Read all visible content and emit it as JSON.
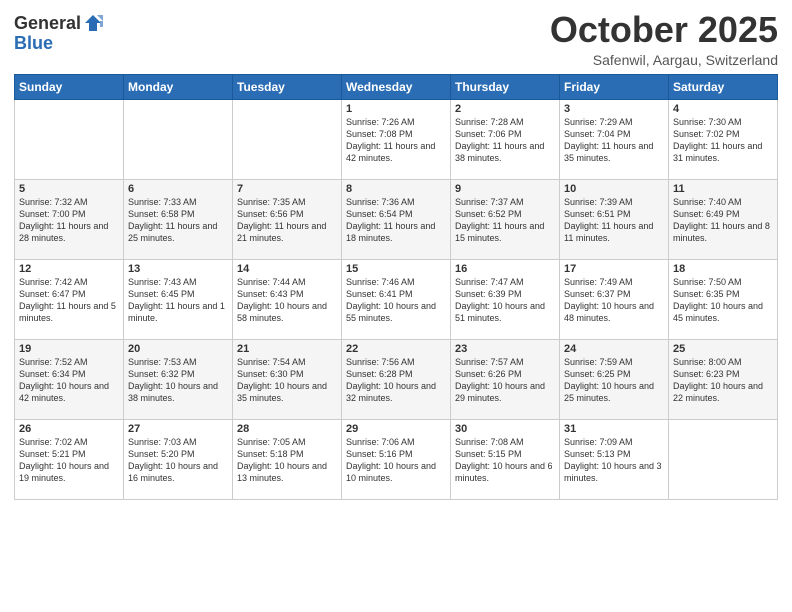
{
  "logo": {
    "general": "General",
    "blue": "Blue"
  },
  "title": "October 2025",
  "location": "Safenwil, Aargau, Switzerland",
  "days_of_week": [
    "Sunday",
    "Monday",
    "Tuesday",
    "Wednesday",
    "Thursday",
    "Friday",
    "Saturday"
  ],
  "weeks": [
    [
      {
        "num": "",
        "info": ""
      },
      {
        "num": "",
        "info": ""
      },
      {
        "num": "",
        "info": ""
      },
      {
        "num": "1",
        "info": "Sunrise: 7:26 AM\nSunset: 7:08 PM\nDaylight: 11 hours and 42 minutes."
      },
      {
        "num": "2",
        "info": "Sunrise: 7:28 AM\nSunset: 7:06 PM\nDaylight: 11 hours and 38 minutes."
      },
      {
        "num": "3",
        "info": "Sunrise: 7:29 AM\nSunset: 7:04 PM\nDaylight: 11 hours and 35 minutes."
      },
      {
        "num": "4",
        "info": "Sunrise: 7:30 AM\nSunset: 7:02 PM\nDaylight: 11 hours and 31 minutes."
      }
    ],
    [
      {
        "num": "5",
        "info": "Sunrise: 7:32 AM\nSunset: 7:00 PM\nDaylight: 11 hours and 28 minutes."
      },
      {
        "num": "6",
        "info": "Sunrise: 7:33 AM\nSunset: 6:58 PM\nDaylight: 11 hours and 25 minutes."
      },
      {
        "num": "7",
        "info": "Sunrise: 7:35 AM\nSunset: 6:56 PM\nDaylight: 11 hours and 21 minutes."
      },
      {
        "num": "8",
        "info": "Sunrise: 7:36 AM\nSunset: 6:54 PM\nDaylight: 11 hours and 18 minutes."
      },
      {
        "num": "9",
        "info": "Sunrise: 7:37 AM\nSunset: 6:52 PM\nDaylight: 11 hours and 15 minutes."
      },
      {
        "num": "10",
        "info": "Sunrise: 7:39 AM\nSunset: 6:51 PM\nDaylight: 11 hours and 11 minutes."
      },
      {
        "num": "11",
        "info": "Sunrise: 7:40 AM\nSunset: 6:49 PM\nDaylight: 11 hours and 8 minutes."
      }
    ],
    [
      {
        "num": "12",
        "info": "Sunrise: 7:42 AM\nSunset: 6:47 PM\nDaylight: 11 hours and 5 minutes."
      },
      {
        "num": "13",
        "info": "Sunrise: 7:43 AM\nSunset: 6:45 PM\nDaylight: 11 hours and 1 minute."
      },
      {
        "num": "14",
        "info": "Sunrise: 7:44 AM\nSunset: 6:43 PM\nDaylight: 10 hours and 58 minutes."
      },
      {
        "num": "15",
        "info": "Sunrise: 7:46 AM\nSunset: 6:41 PM\nDaylight: 10 hours and 55 minutes."
      },
      {
        "num": "16",
        "info": "Sunrise: 7:47 AM\nSunset: 6:39 PM\nDaylight: 10 hours and 51 minutes."
      },
      {
        "num": "17",
        "info": "Sunrise: 7:49 AM\nSunset: 6:37 PM\nDaylight: 10 hours and 48 minutes."
      },
      {
        "num": "18",
        "info": "Sunrise: 7:50 AM\nSunset: 6:35 PM\nDaylight: 10 hours and 45 minutes."
      }
    ],
    [
      {
        "num": "19",
        "info": "Sunrise: 7:52 AM\nSunset: 6:34 PM\nDaylight: 10 hours and 42 minutes."
      },
      {
        "num": "20",
        "info": "Sunrise: 7:53 AM\nSunset: 6:32 PM\nDaylight: 10 hours and 38 minutes."
      },
      {
        "num": "21",
        "info": "Sunrise: 7:54 AM\nSunset: 6:30 PM\nDaylight: 10 hours and 35 minutes."
      },
      {
        "num": "22",
        "info": "Sunrise: 7:56 AM\nSunset: 6:28 PM\nDaylight: 10 hours and 32 minutes."
      },
      {
        "num": "23",
        "info": "Sunrise: 7:57 AM\nSunset: 6:26 PM\nDaylight: 10 hours and 29 minutes."
      },
      {
        "num": "24",
        "info": "Sunrise: 7:59 AM\nSunset: 6:25 PM\nDaylight: 10 hours and 25 minutes."
      },
      {
        "num": "25",
        "info": "Sunrise: 8:00 AM\nSunset: 6:23 PM\nDaylight: 10 hours and 22 minutes."
      }
    ],
    [
      {
        "num": "26",
        "info": "Sunrise: 7:02 AM\nSunset: 5:21 PM\nDaylight: 10 hours and 19 minutes."
      },
      {
        "num": "27",
        "info": "Sunrise: 7:03 AM\nSunset: 5:20 PM\nDaylight: 10 hours and 16 minutes."
      },
      {
        "num": "28",
        "info": "Sunrise: 7:05 AM\nSunset: 5:18 PM\nDaylight: 10 hours and 13 minutes."
      },
      {
        "num": "29",
        "info": "Sunrise: 7:06 AM\nSunset: 5:16 PM\nDaylight: 10 hours and 10 minutes."
      },
      {
        "num": "30",
        "info": "Sunrise: 7:08 AM\nSunset: 5:15 PM\nDaylight: 10 hours and 6 minutes."
      },
      {
        "num": "31",
        "info": "Sunrise: 7:09 AM\nSunset: 5:13 PM\nDaylight: 10 hours and 3 minutes."
      },
      {
        "num": "",
        "info": ""
      }
    ]
  ]
}
